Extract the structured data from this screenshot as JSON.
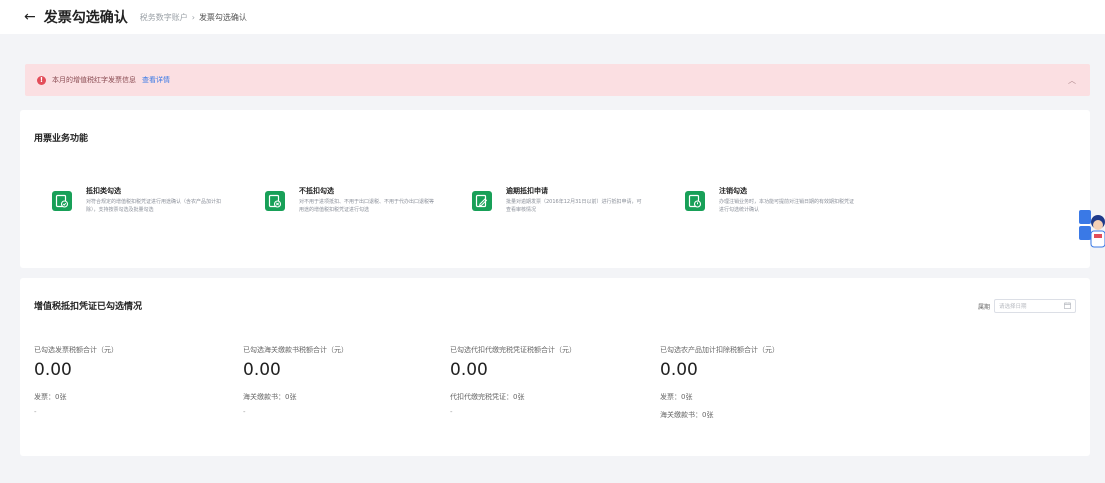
{
  "header": {
    "back_icon": "arrow-left-icon",
    "title": "发票勾选确认",
    "breadcrumb": [
      "税务数字账户",
      "发票勾选确认"
    ]
  },
  "alert": {
    "icon": "error-circle-icon",
    "text": "本月的增值税红字发票信息",
    "link": "查看详情"
  },
  "functions": {
    "title": "用票业务功能",
    "items": [
      {
        "title": "抵扣类勾选",
        "desc": "对符合规定的增值税扣税凭证进行用途确认（含农产品加计扣除），支持按票勾选及批量勾选",
        "icon": "deduct-select-icon"
      },
      {
        "title": "不抵扣勾选",
        "desc": "对不用于进项抵扣、不用于出口退税、不用于代办出口退税等用途的增值税扣税凭证进行勾选",
        "icon": "no-deduct-select-icon"
      },
      {
        "title": "逾期抵扣申请",
        "desc": "批量对逾期发票（2016年12月31日以前）进行抵扣申请，可查看审核情况",
        "icon": "overdue-apply-icon"
      },
      {
        "title": "注销勾选",
        "desc": "办理注销业务时，本功能可提前对注销日期的有效期扣税凭证进行勾选统计确认",
        "icon": "cancel-select-icon"
      }
    ]
  },
  "summary": {
    "title": "增值税抵扣凭证已勾选情况",
    "filter_label": "属期",
    "filter_placeholder": "请选择日期",
    "calendar_icon": "calendar-icon",
    "stats": [
      {
        "label": "已勾选发票税额合计（元）",
        "value": "0.00",
        "lines": [
          "发票：0张"
        ],
        "dash": "-"
      },
      {
        "label": "已勾选海关缴款书税额合计（元）",
        "value": "0.00",
        "lines": [
          "海关缴款书：0张"
        ],
        "dash": "-"
      },
      {
        "label": "已勾选代扣代缴完税凭证税额合计（元）",
        "value": "0.00",
        "lines": [
          "代扣代缴完税凭证：0张"
        ],
        "dash": "-"
      },
      {
        "label": "已勾选农产品加计扣除税额合计（元）",
        "value": "0.00",
        "lines": [
          "发票：0张",
          "海关缴款书：0张"
        ],
        "dash": ""
      }
    ]
  },
  "assistant": {
    "icon": "robot-assistant-icon"
  },
  "colors": {
    "accent": "#18a058",
    "alert_bg": "#fbdfe2",
    "alert_icon": "#e34d59",
    "link": "#3a79e6"
  }
}
